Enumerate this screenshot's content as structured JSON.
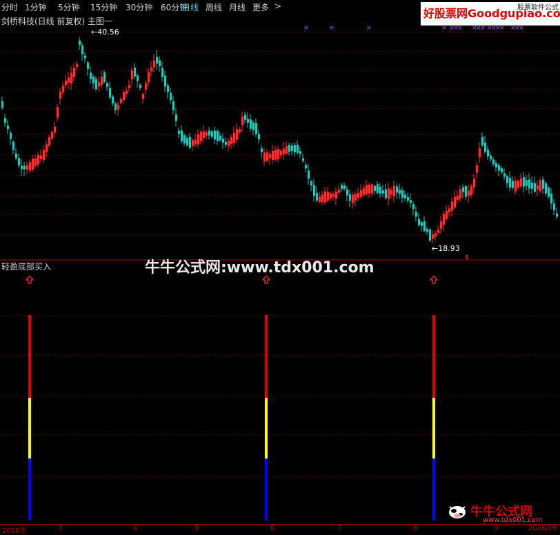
{
  "toolbar": {
    "items": [
      "分时",
      "1分钟",
      "5分钟",
      "15分钟",
      "30分钟",
      "60分钟",
      "日线",
      "周线",
      "月线",
      "更多"
    ],
    "active": "日线",
    "more_arrow": ">"
  },
  "logo": {
    "main": "好股票网Goodgupiao.com",
    "sub": "股票软件公式"
  },
  "stock": {
    "title": "剑桥科技(日线 前复权) 主图一",
    "high_label": "40.56",
    "low_label": "18.93"
  },
  "indicator": {
    "title": "轻盈底部买入"
  },
  "watermark": {
    "text": "牛牛公式网:www.tdx001.com",
    "bottom_text": "牛牛公式网",
    "bottom_sub": "www.tdx001.com"
  },
  "date_axis": {
    "labels": [
      "2018年",
      "3",
      "4",
      "5",
      "6",
      "7",
      "8",
      "9",
      "2018/09"
    ]
  },
  "colors": {
    "up": "#ff3030",
    "down": "#20c8c0",
    "grid": "#900000",
    "buy_red": "#e00000",
    "buy_yellow": "#ffff00",
    "buy_blue": "#0000ff",
    "marker": "#c040ff"
  },
  "signals": {
    "count": 3,
    "bar_segments": [
      "red",
      "yellow",
      "blue"
    ]
  }
}
